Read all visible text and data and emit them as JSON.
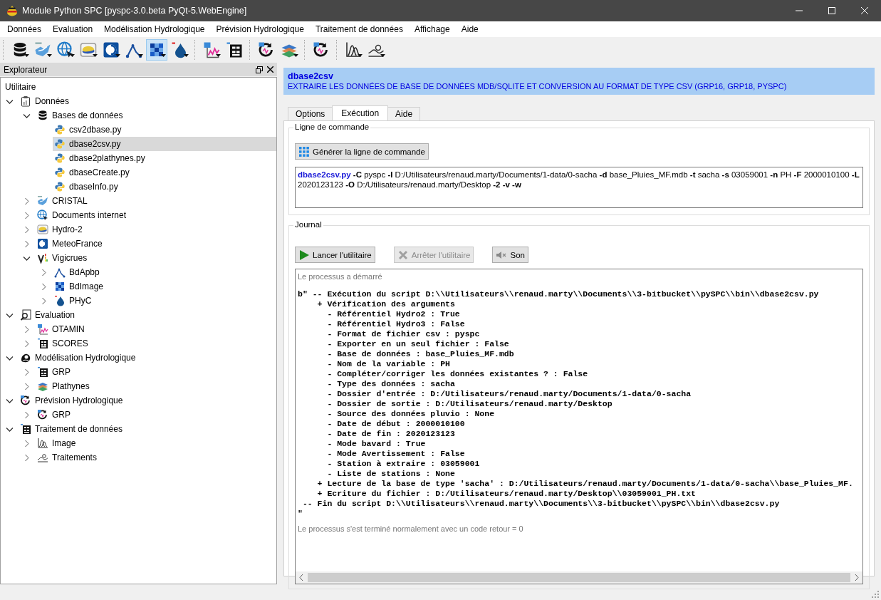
{
  "window": {
    "title": "Module Python SPC [pyspc-3.0.beta PyQt-5.WebEngine]"
  },
  "menu": [
    "Données",
    "Evaluation",
    "Modélisation Hydrologique",
    "Prévision Hydrologique",
    "Traitement de données",
    "Affichage",
    "Aide"
  ],
  "toolbar": [
    [
      {
        "kind": "database",
        "dropdown": true,
        "selected": false
      },
      {
        "kind": "cristal",
        "dropdown": true,
        "selected": false
      },
      {
        "kind": "globe",
        "dropdown": true,
        "selected": false
      },
      {
        "kind": "hydro",
        "dropdown": true,
        "selected": false
      },
      {
        "kind": "meteo",
        "dropdown": true,
        "selected": false
      },
      {
        "kind": "graph",
        "dropdown": true,
        "selected": false
      },
      {
        "kind": "grid",
        "dropdown": true,
        "selected": true
      },
      {
        "kind": "drop",
        "dropdown": true,
        "selected": false
      }
    ],
    [
      {
        "kind": "chart",
        "dropdown": true,
        "selected": false
      },
      {
        "kind": "scores",
        "dropdown": false,
        "selected": false
      }
    ],
    [
      {
        "kind": "cycle",
        "dropdown": false,
        "selected": false
      },
      {
        "kind": "layers",
        "dropdown": true,
        "selected": false
      }
    ],
    [
      {
        "kind": "cycle",
        "dropdown": false,
        "selected": false
      }
    ],
    [
      {
        "kind": "curve",
        "dropdown": true,
        "selected": false
      },
      {
        "kind": "wave",
        "dropdown": true,
        "selected": false
      }
    ]
  ],
  "explorer": {
    "title": "Explorateur",
    "root": "Utilitaire",
    "items": [
      {
        "label": "Données",
        "kind": "clipboard",
        "expanded": true,
        "selected": false,
        "children": [
          {
            "label": "Bases de données",
            "kind": "database",
            "expanded": true,
            "selected": false,
            "children": [
              {
                "label": "csv2dbase.py",
                "kind": "python",
                "selected": false
              },
              {
                "label": "dbase2csv.py",
                "kind": "python",
                "selected": true
              },
              {
                "label": "dbase2plathynes.py",
                "kind": "python",
                "selected": false
              },
              {
                "label": "dbaseCreate.py",
                "kind": "python",
                "selected": false
              },
              {
                "label": "dbaseInfo.py",
                "kind": "python",
                "selected": false
              }
            ]
          },
          {
            "label": "CRISTAL",
            "kind": "cristal",
            "expanded": false,
            "selected": false
          },
          {
            "label": "Documents internet",
            "kind": "globe",
            "expanded": false,
            "selected": false
          },
          {
            "label": "Hydro-2",
            "kind": "hydro",
            "expanded": false,
            "selected": false
          },
          {
            "label": "MeteoFrance",
            "kind": "meteo",
            "expanded": false,
            "selected": false
          },
          {
            "label": "Vigicrues",
            "kind": "vigicrues",
            "expanded": true,
            "selected": false,
            "children": [
              {
                "label": "BdApbp",
                "kind": "graph",
                "expanded": false,
                "selected": false
              },
              {
                "label": "BdImage",
                "kind": "grid",
                "expanded": false,
                "selected": false
              },
              {
                "label": "PHyC",
                "kind": "drop",
                "expanded": false,
                "selected": false
              }
            ]
          }
        ]
      },
      {
        "label": "Evaluation",
        "kind": "search",
        "expanded": true,
        "selected": false,
        "children": [
          {
            "label": "OTAMIN",
            "kind": "chart",
            "expanded": false,
            "selected": false
          },
          {
            "label": "SCORES",
            "kind": "scores",
            "expanded": false,
            "selected": false
          }
        ]
      },
      {
        "label": "Modélisation Hydrologique",
        "kind": "blob",
        "expanded": true,
        "selected": false,
        "children": [
          {
            "label": "GRP",
            "kind": "scores",
            "expanded": false,
            "selected": false
          },
          {
            "label": "Plathynes",
            "kind": "layers",
            "expanded": false,
            "selected": false
          }
        ]
      },
      {
        "label": "Prévision Hydrologique",
        "kind": "cycle",
        "expanded": true,
        "selected": false,
        "children": [
          {
            "label": "GRP",
            "kind": "cycle",
            "expanded": false,
            "selected": false
          }
        ]
      },
      {
        "label": "Traitement de données",
        "kind": "scores",
        "expanded": true,
        "selected": false,
        "children": [
          {
            "label": "Image",
            "kind": "curve",
            "expanded": false,
            "selected": false
          },
          {
            "label": "Traitements",
            "kind": "wave",
            "expanded": false,
            "selected": false
          }
        ]
      }
    ]
  },
  "tool": {
    "name": "dbase2csv",
    "description": "EXTRAIRE LES DONNÉES DE BASE DE DONNÉES MDB/SQLITE ET CONVERSION AU FORMAT DE TYPE CSV (GRP16, GRP18, PYSPC)"
  },
  "tabs": [
    {
      "label": "Options",
      "selected": false
    },
    {
      "label": "Exécution",
      "selected": true
    },
    {
      "label": "Aide",
      "selected": false
    }
  ],
  "command": {
    "title": "Ligne de commande",
    "button": "Générer la ligne de commande",
    "text": "**dbase2csv.py** **-C** pyspc **-I** D:/Utilisateurs/renaud.marty/Documents/1-data/0-sacha **-d** base_Pluies_MF.mdb **-t** sacha **-s** 03059001 **-n** PH **-F** 2000010100 **-L** 2020123123 **-O** D:/Utilisateurs/renaud.marty/Desktop **-2** **-v** **-w**"
  },
  "journal": {
    "title": "Journal",
    "buttons": [
      {
        "label": "Lancer l'utilitaire",
        "kind": "play",
        "disabled": false
      },
      {
        "label": "Arrêter l'utilitaire",
        "kind": "stop",
        "disabled": true
      },
      {
        "label": "Son",
        "kind": "mute",
        "disabled": false
      }
    ],
    "start_message": "Le processus a démarré",
    "lines": [
      "b\" -- Exécution du script D:\\\\Utilisateurs\\\\renaud.marty\\\\Documents\\\\3-bitbucket\\\\pySPC\\\\bin\\\\dbase2csv.py",
      "    + Vérification des arguments",
      "      - Référentiel Hydro2 : True",
      "      - Référentiel Hydro3 : False",
      "      - Format de fichier csv : pyspc",
      "      - Exporter en un seul fichier : False",
      "      - Base de données : base_Pluies_MF.mdb",
      "      - Nom de la variable : PH",
      "      - Compléter/corriger les données existantes ? : False",
      "      - Type des données : sacha",
      "      - Dossier d'entrée : D:/Utilisateurs/renaud.marty/Documents/1-data/0-sacha",
      "      - Dossier de sortie : D:/Utilisateurs/renaud.marty/Desktop",
      "      - Source des données pluvio : None",
      "      - Date de début : 2000010100",
      "      - Date de fin : 2020123123",
      "      - Mode bavard : True",
      "      - Mode Avertissement : False",
      "      - Station à extraire : 03059001",
      "      - Liste de stations : None",
      "    + Lecture de la base de type 'sacha' : D:/Utilisateurs/renaud.marty/Documents/1-data/0-sacha\\\\base_Pluies_MF.",
      "    + Ecriture du fichier : D:/Utilisateurs/renaud.marty/Desktop\\\\03059001_PH.txt",
      " -- Fin du script D:\\\\Utilisateurs\\\\renaud.marty\\\\Documents\\\\3-bitbucket\\\\pySPC\\\\bin\\\\dbase2csv.py",
      "\""
    ],
    "end_message": "Le processus s'est terminé normalement avec un code retour = 0"
  }
}
